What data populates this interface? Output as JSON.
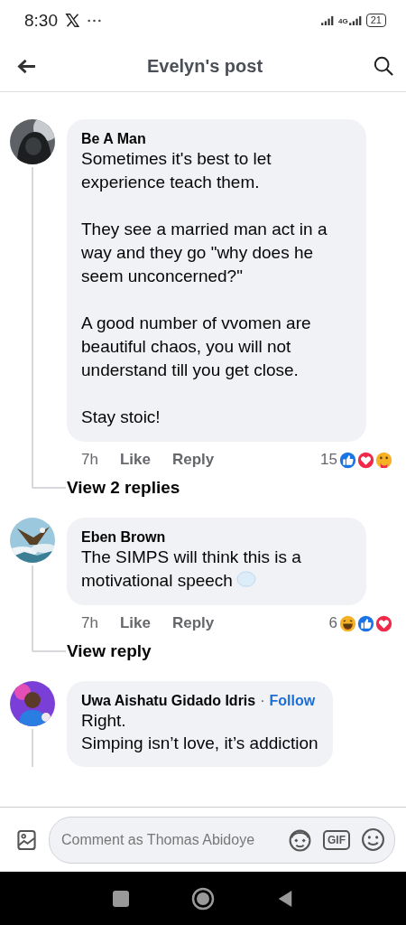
{
  "status_bar": {
    "time": "8:30",
    "network": "4G",
    "battery": "21"
  },
  "header": {
    "title": "Evelyn's post"
  },
  "comments": [
    {
      "author": "Be A Man",
      "paragraphs": [
        "Sometimes it's best to let experience teach them.",
        "They see a married man act in a way and they go \"why does he seem unconcerned?\"",
        "A good number of vvomen are beautiful chaos, you will not understand till you get close.",
        "Stay stoic!"
      ],
      "spaced": true,
      "time": "7h",
      "like": "Like",
      "reply": "Reply",
      "reaction_count": "15",
      "reactions": [
        {
          "kind": "like"
        },
        {
          "kind": "love"
        },
        {
          "kind": "care"
        }
      ],
      "replies_link": "View 2 replies"
    },
    {
      "author": "Eben Brown",
      "paragraphs": [
        "The SIMPS will think this is a motivational speech"
      ],
      "spaced": true,
      "emoji": true,
      "time": "7h",
      "like": "Like",
      "reply": "Reply",
      "reaction_count": "6",
      "reactions": [
        {
          "kind": "haha"
        },
        {
          "kind": "like"
        },
        {
          "kind": "love"
        }
      ],
      "replies_link": "View reply"
    },
    {
      "author": "Uwa Aishatu Gidado Idris",
      "separator": "·",
      "follow": "Follow",
      "paragraphs": [
        "Right.",
        "Simping isn’t love, it’s addiction"
      ],
      "spaced": false
    }
  ],
  "composer": {
    "placeholder": "Comment as Thomas Abidoye",
    "gif_label": "GIF"
  }
}
